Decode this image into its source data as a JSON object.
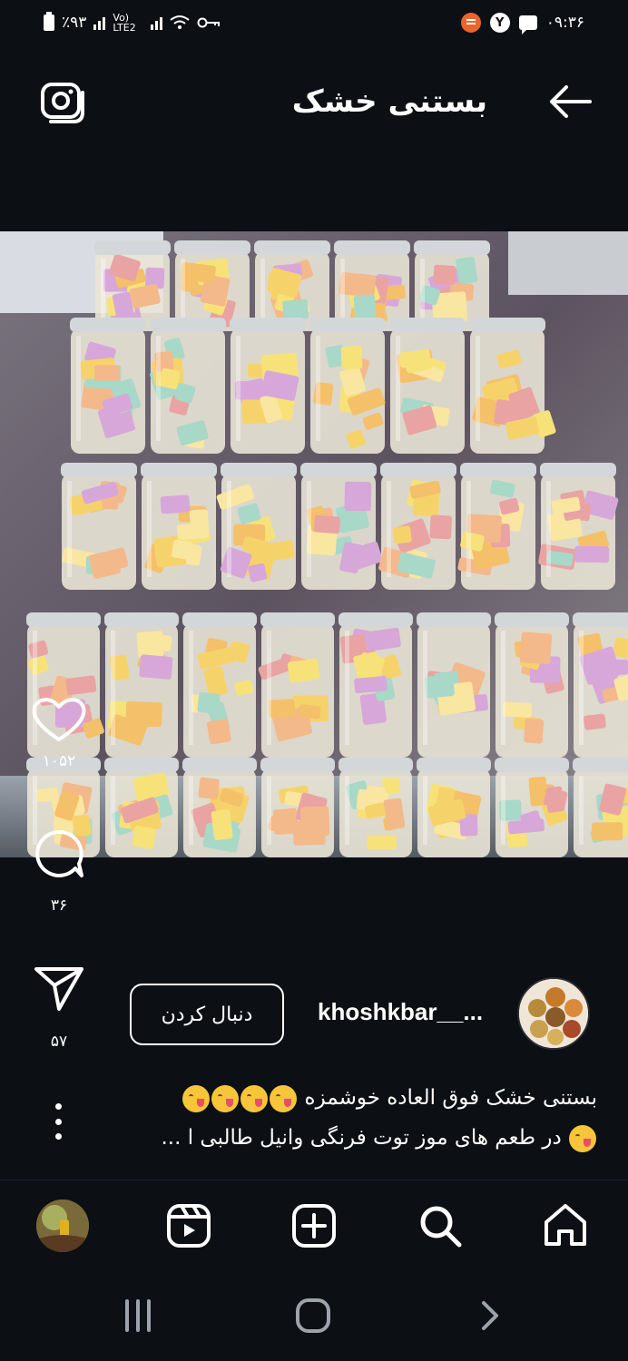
{
  "status_bar": {
    "battery_text": "٪۹۳",
    "network_text": "Vo) LTE2",
    "notif_badge": "Y",
    "time": "۰۹:۳۶"
  },
  "header": {
    "title": "بستنی خشک"
  },
  "actions": {
    "likes": "۱۰۵۲",
    "comments": "۳۶",
    "shares": "۵۷"
  },
  "author": {
    "username": "khoshkbar__...",
    "follow_label": "دنبال کردن"
  },
  "caption": {
    "line1": "بستنی خشک فوق العاده خوشمزه",
    "line2": "در طعم های موز توت فرنگی وانیل طالبی ا ..."
  },
  "colors": {
    "background": "#0c0f14",
    "text": "#ffffff"
  }
}
